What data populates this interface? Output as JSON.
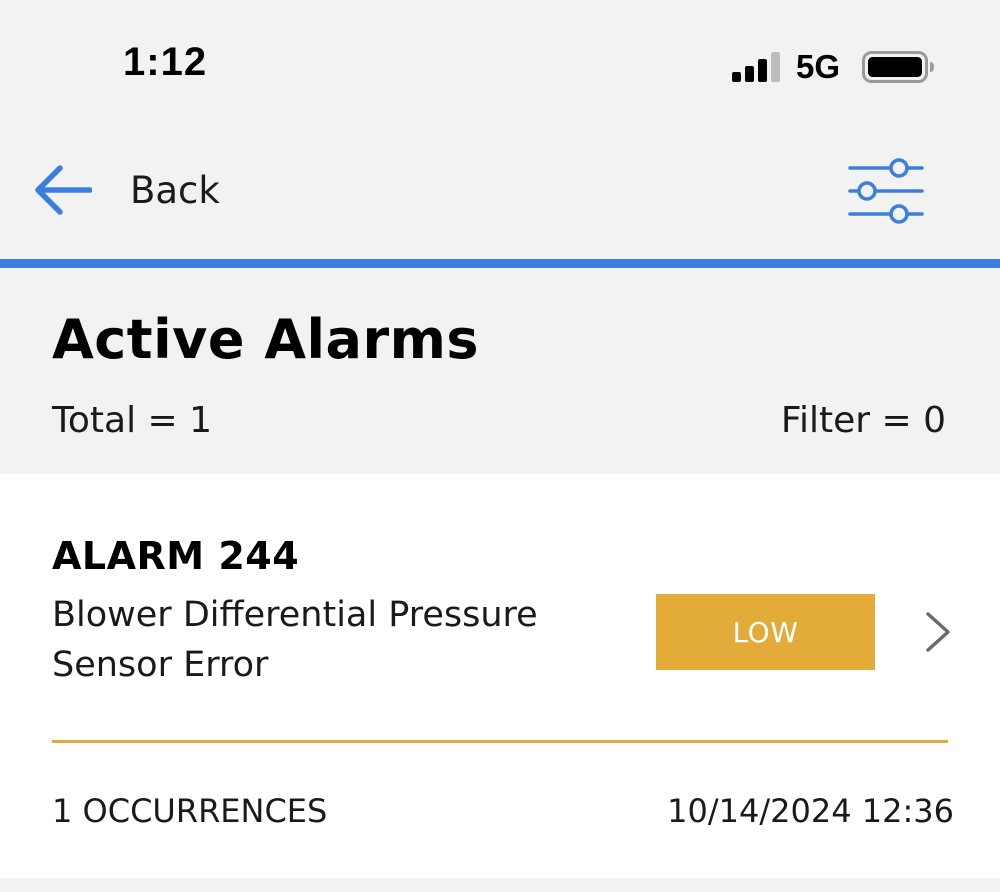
{
  "status_bar": {
    "time": "1:12",
    "network": "5G",
    "signal_icon": "cellular-signal-icon",
    "battery_icon": "battery-icon"
  },
  "nav": {
    "back_label": "Back",
    "back_icon": "arrow-left-icon",
    "filter_icon": "sliders-icon"
  },
  "header": {
    "title": "Active Alarms",
    "total": "Total = 1",
    "filter": "Filter = 0"
  },
  "alarms": [
    {
      "code": "ALARM 244",
      "description": "Blower Differential Pressure Sensor Error",
      "severity": "LOW",
      "occurrences": "1 OCCURRENCES",
      "timestamp": "10/14/2024 12:36"
    }
  ],
  "colors": {
    "accent": "#3b7fde",
    "severity_low": "#e3ab38",
    "background": "#f2f2f2",
    "card": "#ffffff"
  }
}
